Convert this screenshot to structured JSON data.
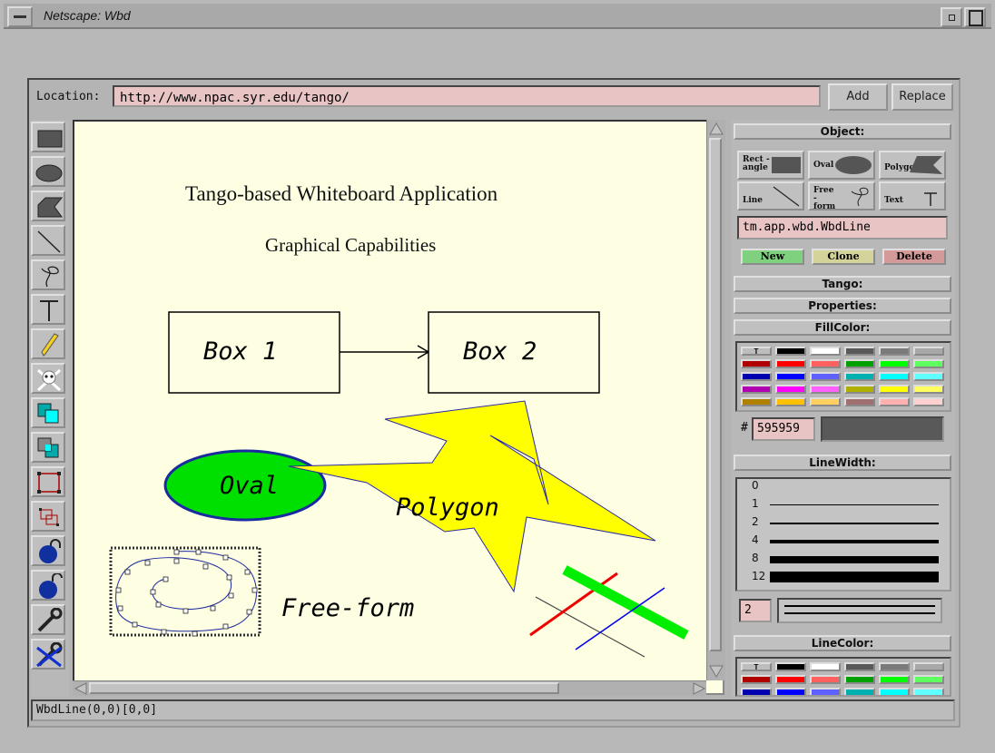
{
  "window": {
    "title": "Netscape: Wbd"
  },
  "location": {
    "label": "Location:",
    "url": "http://www.npac.syr.edu/tango/",
    "add_label": "Add",
    "replace_label": "Replace"
  },
  "tools": [
    "rectangle-icon",
    "oval-icon",
    "polygon-icon",
    "line-icon",
    "freeform-icon",
    "text-icon",
    "pencil-icon",
    "skull-crossbones-icon",
    "bring-front-icon",
    "send-back-icon",
    "group-icon",
    "ungroup-icon",
    "lock-icon",
    "unlock-icon",
    "wrench-icon",
    "delete-wrench-icon"
  ],
  "canvas": {
    "title": "Tango-based Whiteboard Application",
    "subtitle": "Graphical Capabilities",
    "box1": "Box 1",
    "box2": "Box 2",
    "oval": "Oval",
    "polygon": "Polygon",
    "freeform": "Free-form"
  },
  "panel": {
    "object_header": "Object:",
    "obj_rect": "Rect -angle",
    "obj_oval": "Oval",
    "obj_polygon": "Polygon",
    "obj_line": "Line",
    "obj_freeform": "Free -form",
    "obj_text": "Text",
    "class_name": "tm.app.wbd.WbdLine",
    "new_label": "New",
    "clone_label": "Clone",
    "delete_label": "Delete",
    "tango_header": "Tango:",
    "properties_header": "Properties:",
    "fillcolor_header": "FillColor:",
    "hash": "#",
    "fill_hex": "595959",
    "linewidth_header": "LineWidth:",
    "linewidths": [
      "0",
      "1",
      "2",
      "4",
      "8",
      "12"
    ],
    "current_width": "2",
    "linecolor_header": "LineColor:"
  },
  "palette": [
    [
      "#bdbdbd",
      "#000000",
      "#ffffff",
      "#595959",
      "#7a7a7a",
      "#a8a8a8"
    ],
    [
      "#b00000",
      "#ff0000",
      "#ff6060",
      "#00a000",
      "#00ff00",
      "#60ff60"
    ],
    [
      "#0000b0",
      "#0000ff",
      "#6060ff",
      "#00b0b0",
      "#00ffff",
      "#60ffff"
    ],
    [
      "#b000b0",
      "#ff00ff",
      "#ff60ff",
      "#b0b000",
      "#ffff00",
      "#ffff60"
    ],
    [
      "#b08000",
      "#ffc000",
      "#ffd060",
      "#a07070",
      "#ffb0b0",
      "#ffd0d0"
    ]
  ],
  "status": "WbdLine(0,0)[0,0]"
}
